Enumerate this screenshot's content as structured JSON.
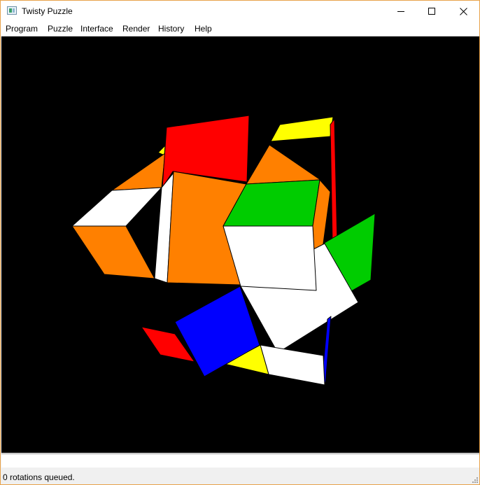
{
  "window": {
    "title": "Twisty Puzzle",
    "icon": "puzzle-app-icon"
  },
  "titlebar_buttons": {
    "minimize": "minimize-icon",
    "maximize": "maximize-icon",
    "close": "close-icon"
  },
  "menu": {
    "items": [
      "Program",
      "Puzzle",
      "Interface",
      "Render",
      "History",
      "Help"
    ]
  },
  "viewport": {
    "background": "#000000",
    "colors": {
      "red": "#ff0000",
      "orange": "#ff8000",
      "green": "#00cc00",
      "blue": "#0000ff",
      "yellow": "#ffff00",
      "white": "#ffffff"
    }
  },
  "command": {
    "value": ""
  },
  "status": {
    "text": "0 rotations queued."
  }
}
